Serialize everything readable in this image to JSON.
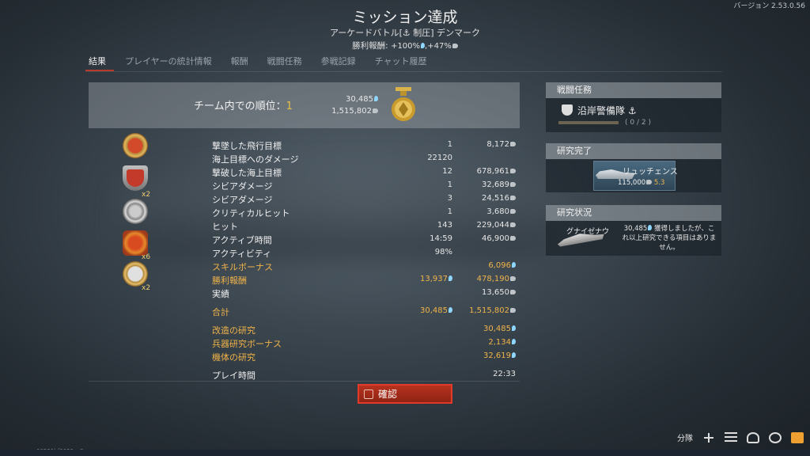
{
  "version": "バージョン 2.53.0.56",
  "header": {
    "title": "ミッション達成",
    "subtitle": "アーケードバトル[⚓ 制圧] デンマーク",
    "reward_label": "勝利報酬:",
    "reward_rp": "+100%",
    "reward_silver": ",+47%"
  },
  "tabs": [
    {
      "label": "結果",
      "active": true
    },
    {
      "label": "プレイヤーの統計情報"
    },
    {
      "label": "報酬"
    },
    {
      "label": "戦闘任務"
    },
    {
      "label": "参戦記録"
    },
    {
      "label": "チャット履歴"
    }
  ],
  "rank": {
    "label": "チーム内での順位：",
    "position": "1",
    "rp": "30,485",
    "silver": "1,515,802"
  },
  "award_multipliers": {
    "a2": "x2",
    "a4": "x6",
    "a5": "x2"
  },
  "stats": [
    {
      "label": "撃墜した飛行目標",
      "c1": "1",
      "c2": "8,172",
      "c2_cur": "silver"
    },
    {
      "label": "海上目標へのダメージ",
      "c1": "22120",
      "c2": ""
    },
    {
      "label": "撃破した海上目標",
      "c1": "12",
      "c2": "678,961",
      "c2_cur": "silver"
    },
    {
      "label": "シビアダメージ",
      "c1": "1",
      "c2": "32,689",
      "c2_cur": "silver"
    },
    {
      "label": "シビアダメージ",
      "c1": "3",
      "c2": "24,516",
      "c2_cur": "silver"
    },
    {
      "label": "クリティカルヒット",
      "c1": "1",
      "c2": "3,680",
      "c2_cur": "silver"
    },
    {
      "label": "ヒット",
      "c1": "143",
      "c2": "229,044",
      "c2_cur": "silver"
    },
    {
      "label": "アクティブ時間",
      "c1": "14:59",
      "c2": "46,900",
      "c2_cur": "silver"
    },
    {
      "label": "アクティビティ",
      "c1": "98%",
      "c2": ""
    },
    {
      "label": "スキルボーナス",
      "c1": "",
      "c2": "6,096",
      "c2_cur": "rp",
      "gold": true
    },
    {
      "label": "勝利報酬",
      "c1": "13,937",
      "c1_cur": "rp",
      "c2": "478,190",
      "c2_cur": "silver",
      "gold": true
    },
    {
      "label": "実績",
      "c1": "",
      "c2": "13,650",
      "c2_cur": "silver"
    },
    {
      "label": "合計",
      "c1": "30,485",
      "c1_cur": "rp",
      "c2": "1,515,802",
      "c2_cur": "silver",
      "gold": true,
      "gap": true
    },
    {
      "label": "改造の研究",
      "c1": "",
      "c2": "30,485",
      "c2_cur": "rp",
      "gold": true,
      "gap": true
    },
    {
      "label": "兵器研究ボーナス",
      "c1": "",
      "c2": "2,134",
      "c2_cur": "rp",
      "gold": true
    },
    {
      "label": "機体の研究",
      "c1": "",
      "c2": "32,619",
      "c2_cur": "rp",
      "gold": true
    },
    {
      "label": "プレイ時間",
      "c1": "",
      "c2": "22:33",
      "gap": true
    }
  ],
  "confirm_label": "確認",
  "side": {
    "mission_head": "戦闘任務",
    "mission_name": "沿岸警備隊 ⚓",
    "mission_progress": "( 0 / 2 )",
    "done_head": "研究完了",
    "done_ship": "リュッチェンス",
    "done_cost": "115,000",
    "done_br": "5.3",
    "research_head": "研究状況",
    "research_ship": "グナイゼナウ",
    "research_text_rp": "30,485",
    "research_text": "獲得しましたが、これ以上研究できる項目はありません。"
  },
  "footer": {
    "squad": "分隊"
  },
  "build_id": "60521bf0053ca9c"
}
